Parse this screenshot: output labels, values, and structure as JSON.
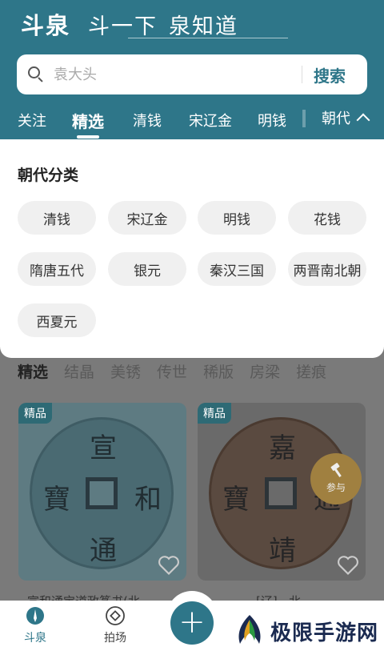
{
  "header": {
    "brand": "斗泉",
    "slogan_part1": "斗一下",
    "slogan_part2": "泉知道",
    "bg_color": "#2e7689"
  },
  "search": {
    "placeholder": "袁大头",
    "button_label": "搜索",
    "icon": "search-icon"
  },
  "tabs": {
    "items": [
      "关注",
      "精选",
      "清钱",
      "宋辽金",
      "明钱"
    ],
    "active": "精选",
    "more_label": "朝代",
    "more_icon": "chevron-up-icon"
  },
  "dynasty_panel": {
    "title": "朝代分类",
    "chips": [
      "清钱",
      "宋辽金",
      "明钱",
      "花钱",
      "隋唐五代",
      "银元",
      "秦汉三国",
      "两晋南北朝",
      "西夏元"
    ]
  },
  "subtabs": {
    "items": [
      "精选",
      "结晶",
      "美锈",
      "传世",
      "稀版",
      "房梁",
      "搓痕"
    ],
    "active": "精选"
  },
  "cards": [
    {
      "badge": "精品",
      "title": "宣和通宝道政篆书(北",
      "coin_chars": [
        "宣",
        "和",
        "通",
        "寶"
      ]
    },
    {
      "badge": "精品",
      "title": "[辽]...北",
      "coin_chars": [
        "嘉",
        "靖",
        "通",
        "寶"
      ]
    }
  ],
  "participate_label": "参与",
  "bottom_nav": {
    "items": [
      {
        "label": "斗泉",
        "icon": "brush-icon",
        "active": true
      },
      {
        "label": "拍场",
        "icon": "auction-icon",
        "active": false
      }
    ],
    "fab_label": "+"
  },
  "watermark": {
    "text": "极限手游网"
  }
}
